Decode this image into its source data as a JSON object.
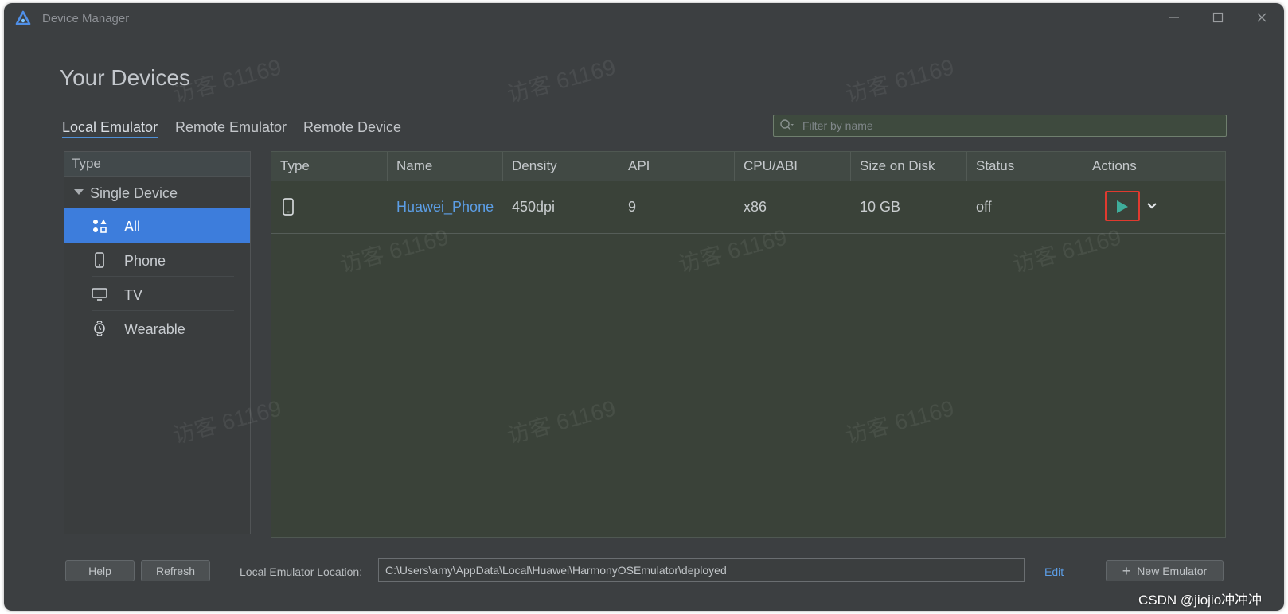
{
  "window": {
    "title": "Device Manager"
  },
  "page": {
    "title": "Your Devices"
  },
  "tabs": [
    {
      "label": "Local Emulator",
      "active": true
    },
    {
      "label": "Remote Emulator",
      "active": false
    },
    {
      "label": "Remote Device",
      "active": false
    }
  ],
  "filter": {
    "placeholder": "Filter by name",
    "value": ""
  },
  "type_panel": {
    "header": "Type",
    "group": "Single Device",
    "items": [
      {
        "label": "All",
        "icon": "grid-shapes-icon",
        "selected": true
      },
      {
        "label": "Phone",
        "icon": "phone-icon",
        "selected": false
      },
      {
        "label": "TV",
        "icon": "tv-icon",
        "selected": false
      },
      {
        "label": "Wearable",
        "icon": "watch-icon",
        "selected": false
      }
    ]
  },
  "table": {
    "columns": [
      "Type",
      "Name",
      "Density",
      "API",
      "CPU/ABI",
      "Size on Disk",
      "Status",
      "Actions"
    ],
    "rows": [
      {
        "type_icon": "phone-icon",
        "name": "Huawei_Phone",
        "density": "450dpi",
        "api": "9",
        "cpu": "x86",
        "size": "10 GB",
        "status": "off"
      }
    ]
  },
  "footer": {
    "help": "Help",
    "refresh": "Refresh",
    "location_label": "Local Emulator Location:",
    "location_value": "C:\\Users\\amy\\AppData\\Local\\Huawei\\HarmonyOSEmulator\\deployed",
    "edit": "Edit",
    "new_emulator": "New Emulator"
  },
  "watermark": "访客 61169",
  "attribution": "CSDN @jiojio冲冲冲",
  "colors": {
    "accent": "#3d7ddc",
    "link": "#5c9ee6",
    "run": "#3fae9b",
    "highlight": "#e03a2f"
  }
}
